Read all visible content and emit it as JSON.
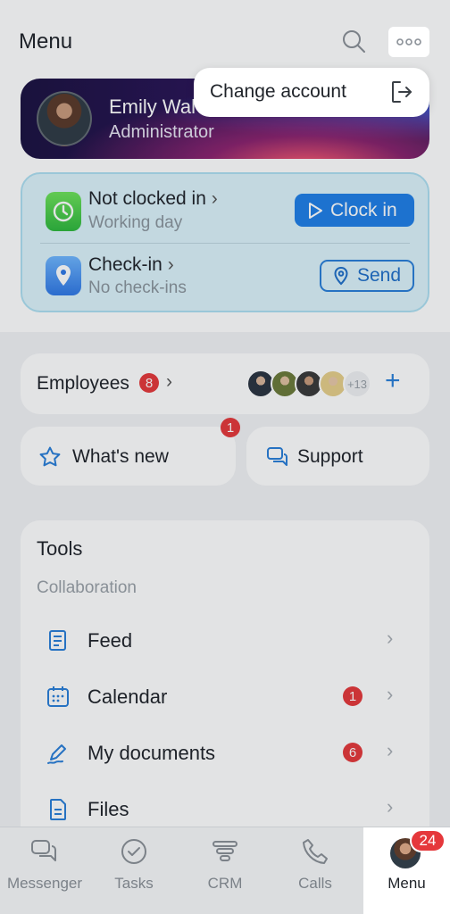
{
  "header": {
    "title": "Menu",
    "search_icon": "search-icon",
    "more_icon": "more-horizontal-icon"
  },
  "popup": {
    "label": "Change account",
    "icon": "logout-icon"
  },
  "profile": {
    "name": "Emily Wal",
    "role": "Administrator"
  },
  "work": {
    "clock": {
      "title": "Not clocked in",
      "subtitle": "Working day",
      "button": "Clock in"
    },
    "checkin": {
      "title": "Check-in",
      "subtitle": "No check-ins",
      "button": "Send"
    }
  },
  "employees": {
    "label": "Employees",
    "count": "8",
    "more": "+13"
  },
  "whats_new": {
    "label": "What's new",
    "badge": "1"
  },
  "support": {
    "label": "Support"
  },
  "tools": {
    "title": "Tools",
    "section": "Collaboration",
    "items": [
      {
        "label": "Feed",
        "icon": "feed-icon",
        "badge": ""
      },
      {
        "label": "Calendar",
        "icon": "calendar-icon",
        "badge": "1"
      },
      {
        "label": "My documents",
        "icon": "signature-icon",
        "badge": "6"
      },
      {
        "label": "Files",
        "icon": "file-icon",
        "badge": ""
      }
    ]
  },
  "tabbar": {
    "items": [
      {
        "label": "Messenger",
        "icon": "chat-bubbles-icon"
      },
      {
        "label": "Tasks",
        "icon": "check-circle-icon"
      },
      {
        "label": "CRM",
        "icon": "funnel-icon"
      },
      {
        "label": "Calls",
        "icon": "phone-icon"
      },
      {
        "label": "Menu",
        "icon": "avatar",
        "badge": "24"
      }
    ]
  },
  "colors": {
    "accent": "#1f7fe8",
    "badge": "#e5383b",
    "work_card": "#dcf3fb"
  }
}
